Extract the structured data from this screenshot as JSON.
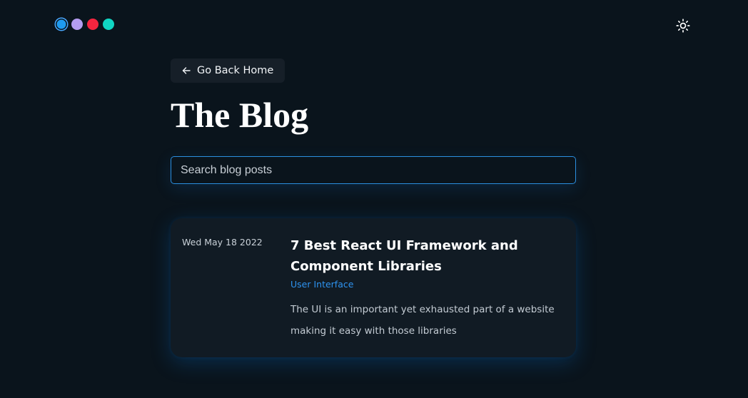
{
  "header": {
    "theme_dots": [
      {
        "name": "blue",
        "color": "#1e9bf0"
      },
      {
        "name": "lavender",
        "color": "#b49cf0"
      },
      {
        "name": "red",
        "color": "#f5253f"
      },
      {
        "name": "teal",
        "color": "#10d6c3"
      }
    ],
    "theme_toggle_icon": "sun-icon"
  },
  "nav": {
    "back_label": "Go Back Home",
    "back_icon": "arrow-left-icon"
  },
  "page": {
    "title": "The Blog"
  },
  "search": {
    "placeholder": "Search blog posts",
    "value": ""
  },
  "posts": [
    {
      "date": "Wed May 18 2022",
      "title": "7 Best React UI Framework and Component Libraries",
      "category": "User Interface",
      "excerpt": "The UI is an important yet exhausted part of a website making it easy with those libraries"
    }
  ],
  "colors": {
    "background": "#0a141c",
    "card": "#111b24",
    "accent": "#2e93f0"
  }
}
